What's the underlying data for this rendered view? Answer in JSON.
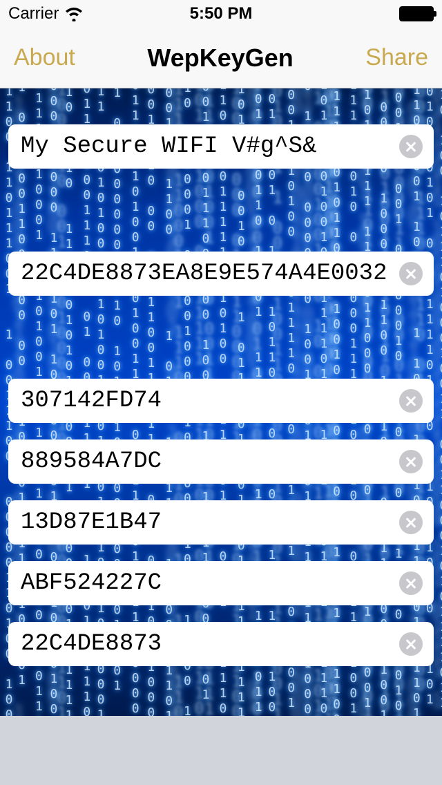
{
  "status": {
    "carrier": "Carrier",
    "time": "5:50 PM"
  },
  "nav": {
    "left": "About",
    "title": "WepKeyGen",
    "right": "Share"
  },
  "fields": {
    "ssid": "My Secure WIFI V#g^S&",
    "key128": "22C4DE8873EA8E9E574A4E0032",
    "keys64": [
      "307142FD74",
      "889584A7DC",
      "13D87E1B47",
      "ABF524227C",
      "22C4DE8873"
    ]
  }
}
